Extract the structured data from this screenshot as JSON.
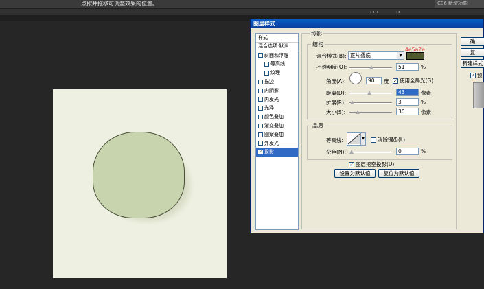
{
  "topbar": {
    "hint": "点按并拖移可调整效果的位置。",
    "workspace_label": "CS6 新增功能"
  },
  "strip": {
    "arrows_left": "◂◂ ▸",
    "arrows_right": "◂◂"
  },
  "dialog": {
    "title": "图层样式",
    "styles_header": "样式",
    "blend_options": "混合选项:默认",
    "styles": [
      {
        "label": "斜面和浮雕",
        "checked": false,
        "indent": false
      },
      {
        "label": "等高线",
        "checked": false,
        "indent": true
      },
      {
        "label": "纹理",
        "checked": false,
        "indent": true
      },
      {
        "label": "描边",
        "checked": false,
        "indent": false
      },
      {
        "label": "内阴影",
        "checked": false,
        "indent": false
      },
      {
        "label": "内发光",
        "checked": false,
        "indent": false
      },
      {
        "label": "光泽",
        "checked": false,
        "indent": false
      },
      {
        "label": "颜色叠加",
        "checked": false,
        "indent": false
      },
      {
        "label": "渐变叠加",
        "checked": false,
        "indent": false
      },
      {
        "label": "图案叠加",
        "checked": false,
        "indent": false
      },
      {
        "label": "外发光",
        "checked": false,
        "indent": false
      },
      {
        "label": "投影",
        "checked": true,
        "indent": false
      }
    ],
    "panel_title": "投影",
    "structure": {
      "legend": "结构",
      "blend_mode_label": "混合模式(B):",
      "blend_mode_value": "正片叠底",
      "color_hex": "4e5a2e",
      "color": "#4e5a2e",
      "opacity_label": "不透明度(O):",
      "opacity_value": "51",
      "opacity_unit": "%",
      "opacity_level": 0.51,
      "angle_label": "角度(A):",
      "angle_value": "90",
      "angle_unit": "度",
      "global_light_label": "使用全局光(G)",
      "global_light_checked": true,
      "distance_label": "距离(D):",
      "distance_value": "43",
      "distance_unit": "像素",
      "spread_label": "扩展(R):",
      "spread_value": "3",
      "spread_unit": "%",
      "size_label": "大小(S):",
      "size_value": "30",
      "size_unit": "像素"
    },
    "quality": {
      "legend": "品质",
      "contour_label": "等高线:",
      "antialias_label": "消除锯齿(L)",
      "noise_label": "杂色(N):",
      "noise_value": "0",
      "noise_unit": "%"
    },
    "knockout_label": "图层挖空投影(U)",
    "set_default_label": "设置为默认值",
    "reset_default_label": "复位为默认值",
    "right_buttons": [
      "确",
      "复",
      "新建样式"
    ],
    "preview_label": "预"
  },
  "canvas": {
    "bg": "#eef1e1",
    "shape_fill": "#c7d4ae"
  }
}
